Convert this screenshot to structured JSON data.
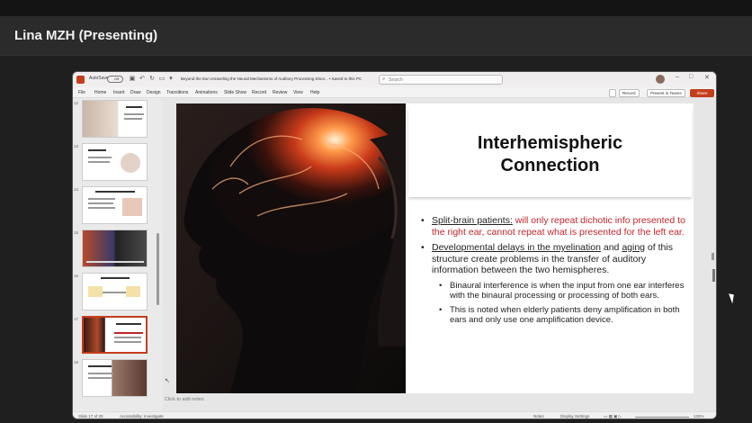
{
  "meeting": {
    "presenter_label": "Lina MZH (Presenting)"
  },
  "titlebar": {
    "autosave_label": "AutoSave",
    "toggle_label": "Off",
    "doc_title": "Beyond the Ear Unraveling the Neural Mechanisms of Auditory Processing Disor... • Saved to this PC",
    "search_placeholder": "Search"
  },
  "ribbon": {
    "menu": [
      "File",
      "Home",
      "Insert",
      "Draw",
      "Design",
      "Transitions",
      "Animations",
      "Slide Show",
      "Record",
      "Review",
      "View",
      "Help"
    ],
    "record_label": "Record",
    "present_label": "Present in Teams",
    "share_label": "Share"
  },
  "thumbnails": {
    "numbers": [
      "12",
      "13",
      "14",
      "15",
      "16",
      "17",
      "18"
    ],
    "active_index": 5
  },
  "slide": {
    "title_line1": "Interhemispheric",
    "title_line2": "Connection",
    "bullet1_head": "Split-brain patients:",
    "bullet1_tail": " will only repeat dichotic info presented to the right ear, cannot repeat what is presented for the left ear.",
    "bullet2_u1": "Developmental delays in the myelination",
    "bullet2_mid": " and ",
    "bullet2_u2": "aging",
    "bullet2_tail": " of this structure create problems in the transfer of auditory information between the two hemispheres.",
    "sub1": "Binaural interference is when the input from one ear interferes with the binaural processing or processing of both ears.",
    "sub2": "This is noted when elderly patients deny amplification in both ears and only use one amplification device.",
    "red_color": "#c0262c"
  },
  "notes_placeholder": "Click to add notes",
  "statusbar": {
    "slide_count": "Slide 17 of 20",
    "accessibility": "Accessibility: Investigate",
    "notes_label": "Notes",
    "display_settings": "Display Settings",
    "zoom": "125%"
  }
}
